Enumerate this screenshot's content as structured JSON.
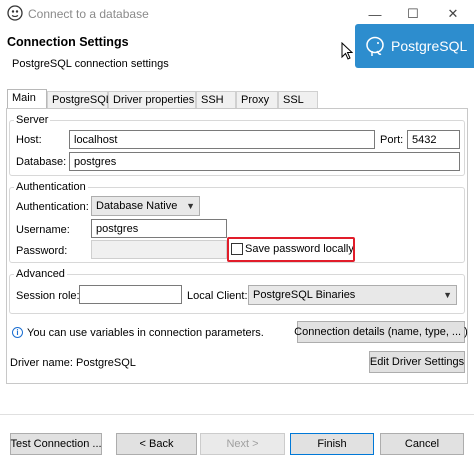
{
  "window": {
    "title": "Connect to a database",
    "minimize": "—",
    "maximize": "☐",
    "close": "✕"
  },
  "header": {
    "title": "Connection Settings",
    "subtitle": "PostgreSQL connection settings",
    "logo_text": "PostgreSQL"
  },
  "tabs": [
    "Main",
    "PostgreSQL",
    "Driver properties",
    "SSH",
    "Proxy",
    "SSL"
  ],
  "server": {
    "group_label": "Server",
    "host_label": "Host:",
    "host_value": "localhost",
    "port_label": "Port:",
    "port_value": "5432",
    "database_label": "Database:",
    "database_value": "postgres"
  },
  "auth": {
    "group_label": "Authentication",
    "auth_label": "Authentication:",
    "auth_value": "Database Native",
    "username_label": "Username:",
    "username_value": "postgres",
    "password_label": "Password:",
    "password_value": "",
    "save_password_label": "Save password locally",
    "save_password_checked": false
  },
  "advanced": {
    "group_label": "Advanced",
    "session_role_label": "Session role:",
    "session_role_value": "",
    "local_client_label": "Local Client:",
    "local_client_value": "PostgreSQL Binaries"
  },
  "info": {
    "text": "You can use variables in connection parameters.",
    "details_button": "Connection details (name, type, ... )"
  },
  "driver": {
    "label": "Driver name:",
    "value": "PostgreSQL",
    "edit_button": "Edit Driver Settings"
  },
  "footer": {
    "test_button": "Test Connection ...",
    "back_button": "< Back",
    "next_button": "Next >",
    "finish_button": "Finish",
    "cancel_button": "Cancel"
  },
  "colors": {
    "accent": "#0078d7",
    "logo_bg": "#2d8dce",
    "highlight": "#e11d2a"
  }
}
